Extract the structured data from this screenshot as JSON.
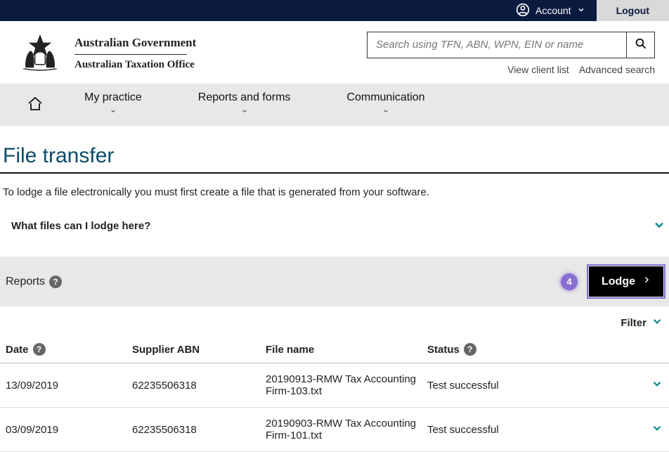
{
  "topbar": {
    "account_label": "Account",
    "logout_label": "Logout"
  },
  "crest": {
    "line1": "Australian Government",
    "line2": "Australian Taxation Office"
  },
  "search": {
    "placeholder": "Search using TFN, ABN, WPN, EIN or name",
    "link_view_client_list": "View client list",
    "link_advanced_search": "Advanced search"
  },
  "nav": {
    "items": [
      {
        "label": "My practice"
      },
      {
        "label": "Reports and forms"
      },
      {
        "label": "Communication"
      }
    ]
  },
  "page": {
    "title": "File transfer",
    "intro": "To lodge a file electronically you must first create a file that is generated from your software."
  },
  "accordion": {
    "what_files": "What files can I lodge here?"
  },
  "reports_bar": {
    "label": "Reports",
    "count": "4",
    "lodge_label": "Lodge"
  },
  "filter": {
    "label": "Filter"
  },
  "table": {
    "headers": {
      "date": "Date",
      "supplier_abn": "Supplier ABN",
      "file_name": "File name",
      "status": "Status"
    },
    "rows": [
      {
        "date": "13/09/2019",
        "abn": "62235506318",
        "file": "20190913-RMW Tax Accounting Firm-103.txt",
        "status": "Test successful"
      },
      {
        "date": "03/09/2019",
        "abn": "62235506318",
        "file": "20190903-RMW Tax Accounting Firm-101.txt",
        "status": "Test successful"
      }
    ]
  }
}
